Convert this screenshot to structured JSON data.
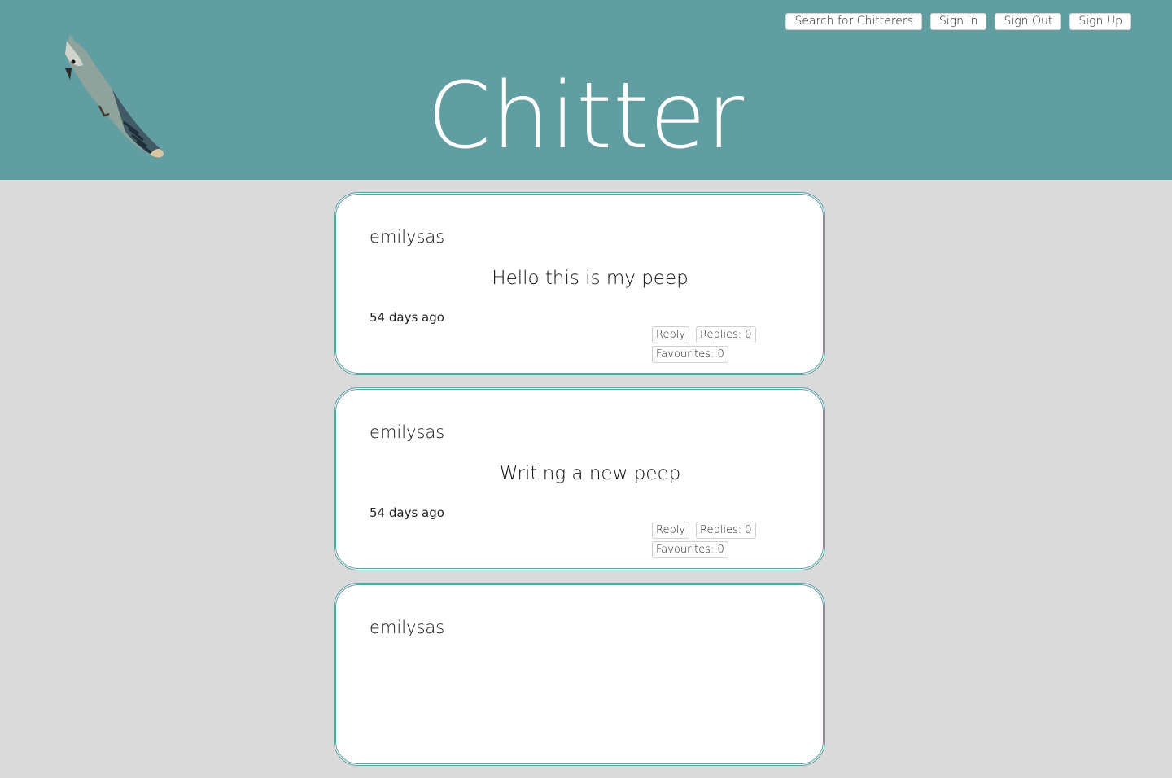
{
  "app": {
    "title": "Chitter"
  },
  "nav": {
    "search_label": "Search for Chitterers",
    "signin_label": "Sign In",
    "signout_label": "Sign Out",
    "signup_label": "Sign Up"
  },
  "colors": {
    "header": "#609ea2",
    "background": "#dadada",
    "card_border": "#609ea2"
  },
  "peeps": [
    {
      "user": "emilysas",
      "text": "Hello this is my peep",
      "time": "54 days ago",
      "reply_label": "Reply",
      "replies_label": "Replies: 0",
      "favourites_label": "Favourites: 0"
    },
    {
      "user": "emilysas",
      "text": "Writing a new peep",
      "time": "54 days ago",
      "reply_label": "Reply",
      "replies_label": "Replies: 0",
      "favourites_label": "Favourites: 0"
    },
    {
      "user": "emilysas"
    }
  ]
}
